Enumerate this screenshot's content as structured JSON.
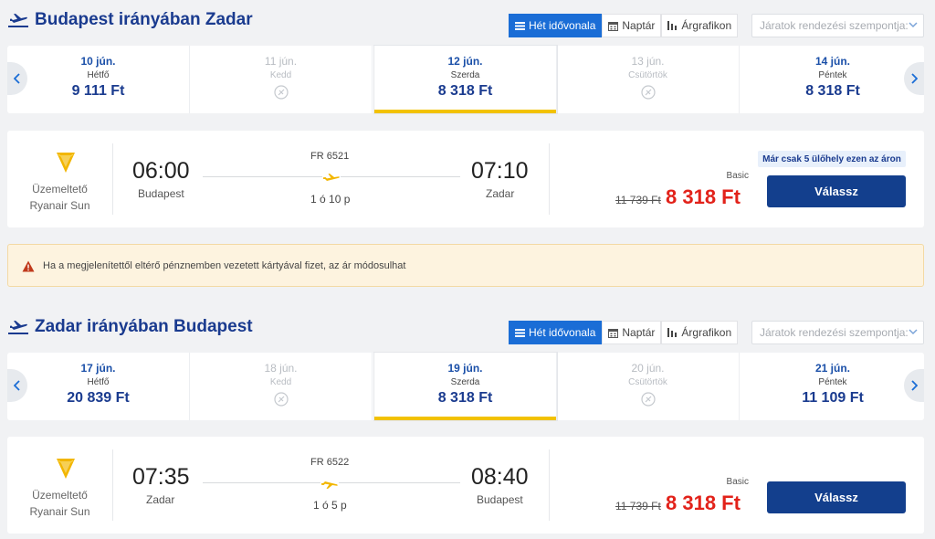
{
  "colors": {
    "accent": "#1a6dd6",
    "title": "#1a3b8f",
    "price_red": "#e2221a",
    "select_yellow": "#f2c200",
    "warning_bg": "#fdf3df"
  },
  "view_buttons": [
    {
      "label": "Hét idővonala",
      "icon": "list-icon",
      "active": true
    },
    {
      "label": "Naptár",
      "icon": "calendar-icon",
      "active": false
    },
    {
      "label": "Árgrafikon",
      "icon": "bar-chart-icon",
      "active": false
    }
  ],
  "sort_placeholder": "Járatok rendezési szempontja:",
  "sections": [
    {
      "title": "Budapest irányában Zadar",
      "dates": [
        {
          "date": "10 jún.",
          "day": "Hétfő",
          "price": "9 111 Ft",
          "available": true,
          "selected": false
        },
        {
          "date": "11 jún.",
          "day": "Kedd",
          "price": "",
          "available": false,
          "selected": false
        },
        {
          "date": "12 jún.",
          "day": "Szerda",
          "price": "8 318 Ft",
          "available": true,
          "selected": true
        },
        {
          "date": "13 jún.",
          "day": "Csütörtök",
          "price": "",
          "available": false,
          "selected": false
        },
        {
          "date": "14 jún.",
          "day": "Péntek",
          "price": "8 318 Ft",
          "available": true,
          "selected": false
        }
      ],
      "flight": {
        "operator_label": "Üzemeltető",
        "operator": "Ryanair Sun",
        "depart_time": "06:00",
        "depart_city": "Budapest",
        "flight_number": "FR 6521",
        "duration": "1 ó 10 p",
        "arrive_time": "07:10",
        "arrive_city": "Zadar",
        "fare_class": "Basic",
        "old_price": "11 739 Ft",
        "price": "8 318 Ft",
        "seat_notice": "Már csak 5 ülőhely ezen az áron",
        "select_label": "Válassz"
      }
    },
    {
      "title": "Zadar irányában Budapest",
      "dates": [
        {
          "date": "17 jún.",
          "day": "Hétfő",
          "price": "20 839 Ft",
          "available": true,
          "selected": false
        },
        {
          "date": "18 jún.",
          "day": "Kedd",
          "price": "",
          "available": false,
          "selected": false
        },
        {
          "date": "19 jún.",
          "day": "Szerda",
          "price": "8 318 Ft",
          "available": true,
          "selected": true
        },
        {
          "date": "20 jún.",
          "day": "Csütörtök",
          "price": "",
          "available": false,
          "selected": false
        },
        {
          "date": "21 jún.",
          "day": "Péntek",
          "price": "11 109 Ft",
          "available": true,
          "selected": false
        }
      ],
      "flight": {
        "operator_label": "Üzemeltető",
        "operator": "Ryanair Sun",
        "depart_time": "07:35",
        "depart_city": "Zadar",
        "flight_number": "FR 6522",
        "duration": "1 ó 5 p",
        "arrive_time": "08:40",
        "arrive_city": "Budapest",
        "fare_class": "Basic",
        "old_price": "11 739 Ft",
        "price": "8 318 Ft",
        "seat_notice": "",
        "select_label": "Válassz"
      }
    }
  ],
  "warning": {
    "icon": "warning-icon",
    "text": "Ha a megjelenítettől eltérő pénznemben vezetett kártyával fizet, az ár módosulhat"
  }
}
